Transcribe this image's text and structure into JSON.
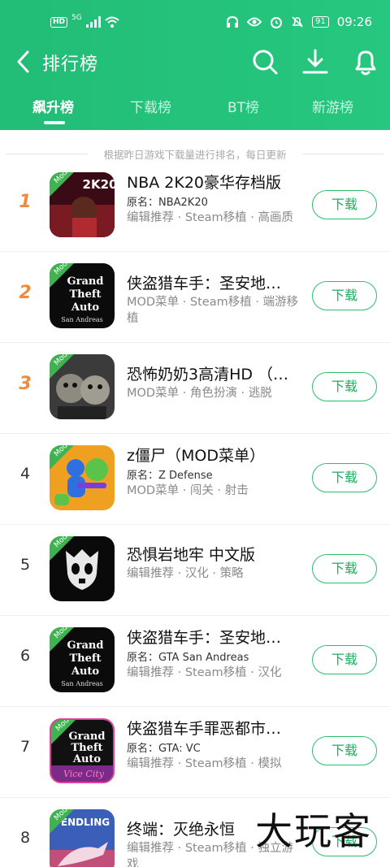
{
  "status": {
    "time": "09:26",
    "battery": "91",
    "hd": "HD",
    "signal": "5G"
  },
  "header": {
    "title": "排行榜"
  },
  "tabs": [
    "飙升榜",
    "下载榜",
    "BT榜",
    "新游榜"
  ],
  "hint": "根据昨日游戏下载量进行排名，每日更新",
  "list": [
    {
      "rank": "1",
      "name": "NBA 2K20豪华存档版",
      "orig": "原名：NBA2K20",
      "tags": "编辑推荐 · Steam移植 · 高画质",
      "button": "下载",
      "mod": "Mod",
      "icon_text": "2K20"
    },
    {
      "rank": "2",
      "name": "侠盗猎车手：圣安地…",
      "orig": "",
      "tags": "MOD菜单 · Steam移植 · 端游移植",
      "button": "下载",
      "mod": "Mod",
      "icon_text": "Grand Theft Auto"
    },
    {
      "rank": "3",
      "name": "恐怖奶奶3高清HD （…",
      "orig": "",
      "tags": "MOD菜单 · 角色扮演 · 逃脱",
      "button": "下载",
      "mod": "Mod",
      "icon_text": ""
    },
    {
      "rank": "4",
      "name": "z僵尸（MOD菜单）",
      "orig": "原名：Z Defense",
      "tags": "MOD菜单 · 闯关 · 射击",
      "button": "下载",
      "mod": "Mod",
      "icon_text": ""
    },
    {
      "rank": "5",
      "name": "恐惧岩地牢 中文版",
      "orig": "",
      "tags": "编辑推荐 · 汉化 · 策略",
      "button": "下载",
      "mod": "Mod",
      "icon_text": ""
    },
    {
      "rank": "6",
      "name": "侠盗猎车手：圣安地…",
      "orig": "原名：GTA San Andreas",
      "tags": "编辑推荐 · Steam移植 · 汉化",
      "button": "下载",
      "mod": "Mod",
      "icon_text": "Grand Theft Auto"
    },
    {
      "rank": "7",
      "name": "侠盗猎车手罪恶都市…",
      "orig": "原名：GTA: VC",
      "tags": "编辑推荐 · Steam移植 · 模拟",
      "button": "下载",
      "mod": "Mod",
      "icon_text": "Grand Theft Auto"
    },
    {
      "rank": "8",
      "name": "终端：灭绝永恒",
      "orig": "",
      "tags": "编辑推荐 · Steam移植 · 独立游戏",
      "button": "下载",
      "mod": "Mod",
      "icon_text": "ENDLING"
    }
  ],
  "watermark": "大玩客",
  "colors": {
    "header": "#22bd77",
    "accent": "#2bbf6d",
    "rank_top": "#f08a3c"
  }
}
